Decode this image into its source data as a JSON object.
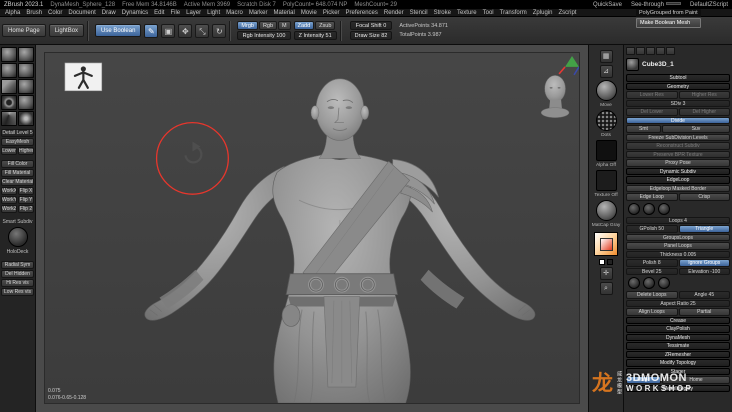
{
  "title_bar": {
    "app_title": "ZBrush 2023.1",
    "stats": [
      "DynaMesh_Sphere_128",
      "Free Mem 34.8146B",
      "Active Mem 3969",
      "Scratch Disk 7",
      "PolyCount= 648.074 NP",
      "MeshCount= 29"
    ],
    "quicksave": "QuickSave",
    "see_through": "See-through",
    "default_zscript": "DefaultZScript"
  },
  "menu_bar": {
    "items": [
      "Alpha",
      "Brush",
      "Color",
      "Document",
      "Draw",
      "Dynamics",
      "Edit",
      "File",
      "Layer",
      "Light",
      "Macro",
      "Marker",
      "Material",
      "Movie",
      "Picker",
      "Preferences",
      "Render",
      "Stencil",
      "Stroke",
      "Texture",
      "Tool",
      "Transform",
      "Zplugin",
      "Zscript"
    ]
  },
  "toolbar": {
    "home_page": "Home Page",
    "lightbox": "LightBox",
    "use_boolean": "Use Boolean",
    "mrgb": "Mrgb",
    "rgb": "Rgb",
    "m": "M",
    "rgb_intensity": "Rgb Intensity 100",
    "zadd": "Zadd",
    "zsub": "Zsub",
    "z_intensity": "Z Intensity 51",
    "focal_shift": "Focal Shift 0",
    "draw_size": "Draw Size 82",
    "active_points": "ActivePoints 34.871",
    "total_points": "TotalPoints 3.987"
  },
  "tooltip": {
    "line1": "PolyGrouped from Paint",
    "line2": "Make Boolean Mesh"
  },
  "left_panel": {
    "thumbnails": [
      "sphere",
      "sphere",
      "sphere",
      "sphere",
      "cube",
      "sphere",
      "ring",
      "sphere",
      "cone",
      "star"
    ],
    "rows": [
      [
        {
          "label": "Detail Level 5",
          "style": "slider"
        }
      ],
      [
        {
          "label": "EasyMesh",
          "style": "btn"
        }
      ],
      [
        {
          "label": "Lower",
          "style": "btn"
        },
        {
          "label": "Higher",
          "style": "btn"
        }
      ],
      [
        {
          "label": "",
          "style": "gap"
        }
      ],
      [
        {
          "label": "Fill Color",
          "style": "btn"
        }
      ],
      [
        {
          "label": "Fill Material",
          "style": "btn"
        }
      ],
      [
        {
          "label": "Clear Material",
          "style": "btn"
        }
      ],
      [
        {
          "label": "WorkX",
          "style": "btn"
        },
        {
          "label": "Flip X",
          "style": "btn"
        }
      ],
      [
        {
          "label": "WorkY",
          "style": "btn"
        },
        {
          "label": "Flip Y",
          "style": "btn"
        }
      ],
      [
        {
          "label": "WorkZ",
          "style": "btn"
        },
        {
          "label": "Flip 2",
          "style": "btn"
        }
      ],
      [
        {
          "label": "",
          "style": "gap"
        }
      ],
      [
        {
          "label": "Smart Subdiv",
          "style": "label"
        }
      ],
      [
        {
          "label": "",
          "style": "holodeck"
        }
      ],
      [
        {
          "label": "HoloDeck",
          "style": "label"
        }
      ],
      [
        {
          "label": "",
          "style": "gap"
        }
      ],
      [
        {
          "label": "Radial Sym",
          "style": "btn"
        }
      ],
      [
        {
          "label": "Del Hidden",
          "style": "btn"
        }
      ],
      [
        {
          "label": "Hi Res vis",
          "style": "btn"
        }
      ],
      [
        {
          "label": "Low Res vis",
          "style": "btn"
        }
      ]
    ]
  },
  "viewport": {
    "coords_line1": "0.075",
    "coords_line2": "0.076-0.65-0.128"
  },
  "right_shelf": {
    "brush_label": "Move",
    "stroke_label": "Dots",
    "alpha_label": "Alpha Off",
    "texture_label": "Texture Off",
    "material_label": "MatCap Gray"
  },
  "right_panel": {
    "tool_name": "Cube3D_1",
    "rows": [
      [
        {
          "label": "Subtool",
          "style": "header"
        }
      ],
      [
        {
          "label": "Geometry",
          "style": "header"
        }
      ],
      [
        {
          "label": "Lower Res",
          "style": "dim"
        },
        {
          "label": "Higher Res",
          "style": "dim"
        }
      ],
      [
        {
          "label": "SDiv 3",
          "style": "slider"
        }
      ],
      [
        {
          "label": "Del Lower",
          "style": "dim"
        },
        {
          "label": "Del Higher",
          "style": "dim"
        }
      ],
      [
        {
          "label": "Divide",
          "style": "blue"
        }
      ],
      [
        {
          "label": "Smt",
          "style": "btn",
          "w": "1"
        },
        {
          "label": "Suv",
          "style": "btn",
          "w": "2"
        }
      ],
      [
        {
          "label": "Freeze SubDivision Levels",
          "style": "btn"
        }
      ],
      [
        {
          "label": "Reconstruct Subdiv",
          "style": "dim"
        }
      ],
      [
        {
          "label": "Preserve BPR Texture",
          "style": "dim"
        }
      ],
      [
        {
          "label": "Proxy Pose",
          "style": "btn"
        }
      ],
      [
        {
          "label": "Dynamic Subdiv",
          "style": "header"
        }
      ],
      [
        {
          "label": "EdgeLoop",
          "style": "header"
        }
      ],
      [
        {
          "label": "Edgeloop Masked Border",
          "style": "btn"
        }
      ],
      [
        {
          "label": "Edge Loop",
          "style": "btn"
        },
        {
          "label": "Crisp",
          "style": "btn"
        }
      ],
      [
        {
          "label": "",
          "style": "knobs3"
        }
      ],
      [
        {
          "label": "Loops 4",
          "style": "slider"
        }
      ],
      [
        {
          "label": "GPolish 50",
          "style": "slider"
        },
        {
          "label": "Triangle",
          "style": "blue"
        }
      ],
      [
        {
          "label": "GroupsLoops",
          "style": "btn"
        }
      ],
      [
        {
          "label": "Panel Loops",
          "style": "btn"
        }
      ],
      [
        {
          "label": "Thickness 0.005",
          "style": "slider"
        }
      ],
      [
        {
          "label": "Polish 8",
          "style": "slider"
        },
        {
          "label": "Ignore Groups",
          "style": "blue"
        }
      ],
      [
        {
          "label": "Bevel 25",
          "style": "slider"
        },
        {
          "label": "Elevation -100",
          "style": "slider"
        }
      ],
      [
        {
          "label": "",
          "style": "knobs3"
        }
      ],
      [
        {
          "label": "Delete Loops",
          "style": "btn"
        },
        {
          "label": "Angle 45",
          "style": "slider"
        }
      ],
      [
        {
          "label": "Aspect Ratio 25",
          "style": "slider"
        }
      ],
      [
        {
          "label": "Align Loops",
          "style": "btn"
        },
        {
          "label": "Partial",
          "style": "btn"
        }
      ],
      [
        {
          "label": "Crease",
          "style": "header"
        }
      ],
      [
        {
          "label": "ClayPolish",
          "style": "header"
        }
      ],
      [
        {
          "label": "DynaMesh",
          "style": "header"
        }
      ],
      [
        {
          "label": "Tessimate",
          "style": "header"
        }
      ],
      [
        {
          "label": "ZRemesher",
          "style": "header"
        }
      ],
      [
        {
          "label": "Modify Topology",
          "style": "header"
        }
      ],
      [
        {
          "label": "Stager",
          "style": "header"
        }
      ],
      [
        {
          "label": "Stage",
          "style": "blue",
          "w": "1"
        },
        {
          "label": "Home",
          "style": "btn",
          "w": "2"
        }
      ],
      [
        {
          "label": "MeshIntegrity",
          "style": "header"
        }
      ]
    ]
  },
  "watermark": {
    "glyph": "龙",
    "cn": "威龙模型",
    "en1": "3DMOMON",
    "en2": "WORKSHOP",
    "accent": "#e87c1e"
  }
}
